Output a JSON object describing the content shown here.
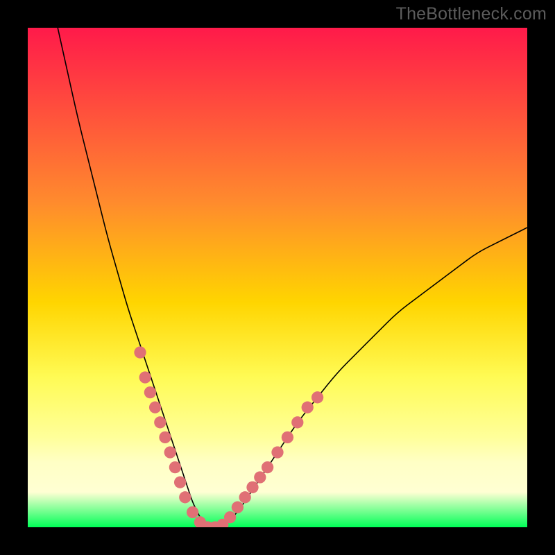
{
  "watermark": "TheBottleneck.com",
  "chart_data": {
    "type": "line",
    "title": "",
    "xlabel": "",
    "ylabel": "",
    "xlim": [
      0,
      100
    ],
    "ylim": [
      0,
      100
    ],
    "gradient_stops": [
      {
        "offset": 0,
        "color": "#ff1a4a"
      },
      {
        "offset": 35,
        "color": "#ff8b2d"
      },
      {
        "offset": 55,
        "color": "#ffd500"
      },
      {
        "offset": 70,
        "color": "#fffb55"
      },
      {
        "offset": 82,
        "color": "#ffff9a"
      },
      {
        "offset": 87,
        "color": "#ffffc5"
      },
      {
        "offset": 93,
        "color": "#ffffd3"
      },
      {
        "offset": 100,
        "color": "#00ff57"
      }
    ],
    "series": [
      {
        "name": "curve",
        "stroke": "#000000",
        "x": [
          6,
          8,
          10,
          12,
          14,
          16,
          18,
          20,
          22,
          24,
          25,
          26,
          27,
          28,
          29,
          30,
          31,
          32,
          33,
          34,
          35,
          36,
          38,
          40,
          42,
          44,
          46,
          48,
          50,
          54,
          58,
          62,
          66,
          70,
          74,
          78,
          82,
          86,
          90,
          94,
          98,
          100
        ],
        "y": [
          100,
          91,
          82,
          74,
          66,
          58,
          51,
          44,
          38,
          32,
          29,
          26,
          23,
          20,
          17,
          14,
          11,
          8,
          5,
          3,
          1,
          0,
          0,
          1,
          3,
          6,
          9,
          12,
          15,
          21,
          26,
          31,
          35,
          39,
          43,
          46,
          49,
          52,
          55,
          57,
          59,
          60
        ]
      }
    ],
    "markers": {
      "color": "#e07075",
      "radius": 1.2,
      "points": [
        {
          "x": 22.5,
          "y": 35
        },
        {
          "x": 23.5,
          "y": 30
        },
        {
          "x": 24.5,
          "y": 27
        },
        {
          "x": 25.5,
          "y": 24
        },
        {
          "x": 26.5,
          "y": 21
        },
        {
          "x": 27.5,
          "y": 18
        },
        {
          "x": 28.5,
          "y": 15
        },
        {
          "x": 29.5,
          "y": 12
        },
        {
          "x": 30.5,
          "y": 9
        },
        {
          "x": 31.5,
          "y": 6
        },
        {
          "x": 33,
          "y": 3
        },
        {
          "x": 34.5,
          "y": 1
        },
        {
          "x": 36,
          "y": 0
        },
        {
          "x": 37.5,
          "y": 0
        },
        {
          "x": 39,
          "y": 0.5
        },
        {
          "x": 40.5,
          "y": 2
        },
        {
          "x": 42,
          "y": 4
        },
        {
          "x": 43.5,
          "y": 6
        },
        {
          "x": 45,
          "y": 8
        },
        {
          "x": 46.5,
          "y": 10
        },
        {
          "x": 48,
          "y": 12
        },
        {
          "x": 50,
          "y": 15
        },
        {
          "x": 52,
          "y": 18
        },
        {
          "x": 54,
          "y": 21
        },
        {
          "x": 56,
          "y": 24
        },
        {
          "x": 58,
          "y": 26
        }
      ]
    }
  }
}
